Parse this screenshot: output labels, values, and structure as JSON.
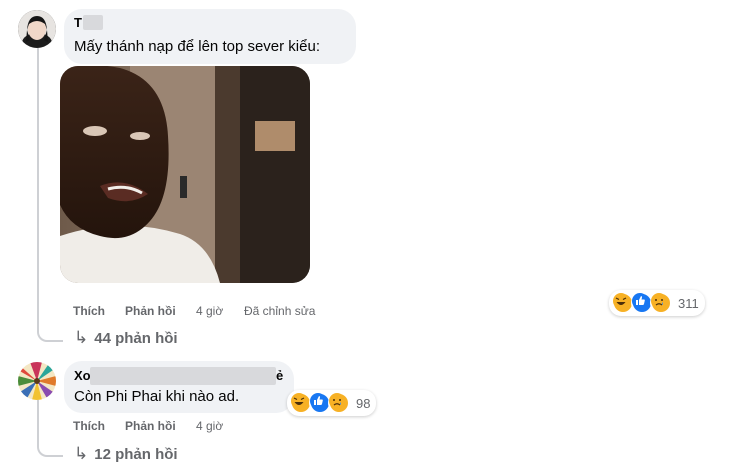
{
  "comments": [
    {
      "author": "T",
      "text": "Mấy thánh nạp để lên top sever kiểu:",
      "actions": {
        "like": "Thích",
        "reply": "Phản hồi"
      },
      "time": "4 giờ",
      "edited": "Đã chỉnh sửa",
      "reaction_count": "311",
      "replies": "44 phản hồi"
    },
    {
      "author_start": "Xo",
      "author_end": "ẻ",
      "text": "Còn Phi Phai khi nào ad.",
      "actions": {
        "like": "Thích",
        "reply": "Phản hồi"
      },
      "time": "4 giờ",
      "reaction_count": "98",
      "replies": "12 phản hồi"
    }
  ],
  "icons": {
    "reactions": [
      "haha-reaction-icon",
      "like-reaction-icon",
      "sad-reaction-icon"
    ],
    "reply_arrow": "reply-arrow-icon"
  },
  "colors": {
    "bubble": "#f0f2f5",
    "muted_text": "#65676b",
    "like_blue": "#1877f2",
    "haha_yellow": "#f7b125"
  }
}
